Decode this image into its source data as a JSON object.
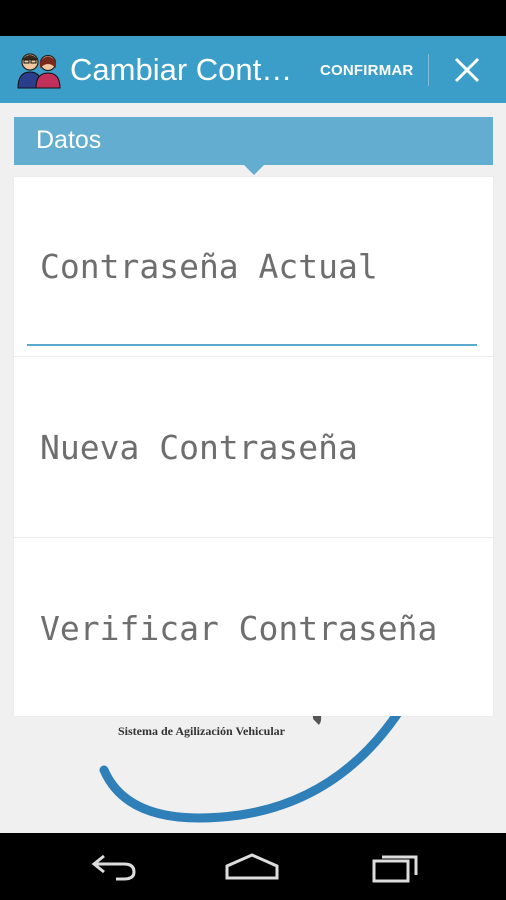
{
  "action_bar": {
    "title": "Cambiar Cont…",
    "confirm_label": "CONFIRMAR",
    "app_icon": "users-icon",
    "close_icon": "close-icon",
    "color": "#3a9ec8"
  },
  "tabs": {
    "active_label": "Datos",
    "color": "#62add0"
  },
  "form": {
    "fields": [
      {
        "placeholder": "Contraseña Actual",
        "focused": true
      },
      {
        "placeholder": "Nueva Contraseña",
        "focused": false
      },
      {
        "placeholder": "Verificar Contraseña",
        "focused": false
      }
    ]
  },
  "background": {
    "logo_caption": "Sistema de Agilización Vehicular"
  },
  "nav_bar": {
    "back_icon": "back-icon",
    "home_icon": "home-icon",
    "recents_icon": "recents-icon"
  }
}
